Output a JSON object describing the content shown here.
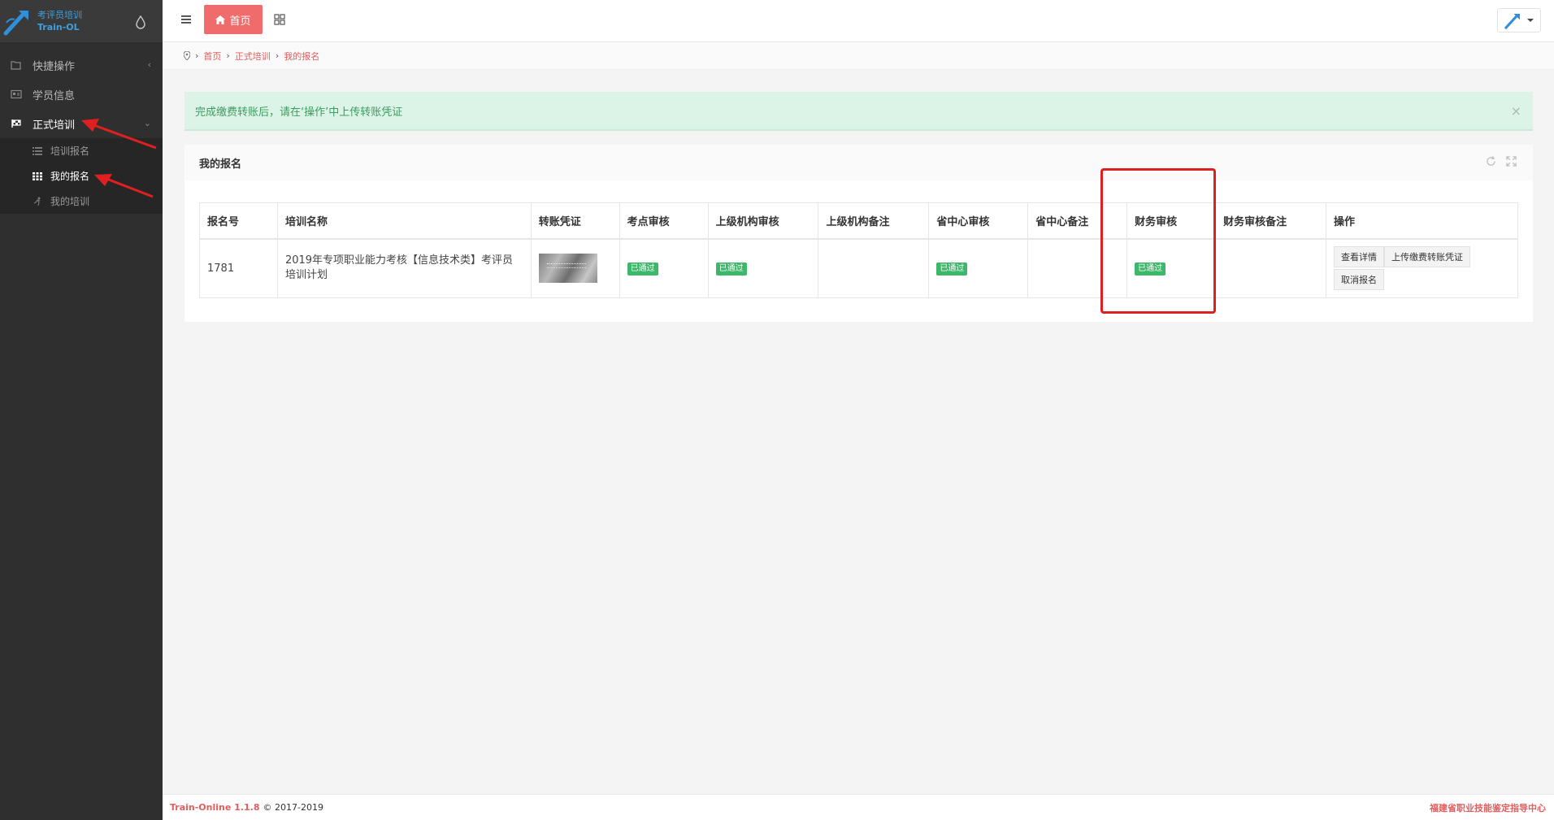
{
  "brand": {
    "cn": "考评员培训",
    "en": "Train-OL"
  },
  "sidebar": {
    "items": [
      {
        "label": "快捷操作"
      },
      {
        "label": "学员信息"
      },
      {
        "label": "正式培训"
      }
    ],
    "sub": [
      {
        "label": "培训报名"
      },
      {
        "label": "我的报名"
      },
      {
        "label": "我的培训"
      }
    ]
  },
  "topbar": {
    "home": "首页"
  },
  "breadcrumb": [
    "首页",
    "正式培训",
    "我的报名"
  ],
  "alert": {
    "text": "完成缴费转账后，请在‘操作’中上传转账凭证",
    "close": "×"
  },
  "panel": {
    "title": "我的报名"
  },
  "table": {
    "headers": [
      "报名号",
      "培训名称",
      "转账凭证",
      "考点审核",
      "上级机构审核",
      "上级机构备注",
      "省中心审核",
      "省中心备注",
      "财务审核",
      "财务审核备注",
      "操作"
    ],
    "row": {
      "id": "1781",
      "name": "2019年专项职业能力考核【信息技术类】考评员培训计划",
      "kd": "已通过",
      "sj": "已通过",
      "szx": "已通过",
      "cw": "已通过"
    },
    "ops": [
      "查看详情",
      "上传缴费转账凭证",
      "取消报名"
    ]
  },
  "footer": {
    "version": "Train-Online 1.1.8",
    "copy": "© 2017-2019",
    "org": "福建省职业技能鉴定指导中心"
  },
  "colors": {
    "accent": "#f06b6b",
    "success": "#3db76a",
    "highlight": "#e02020"
  }
}
